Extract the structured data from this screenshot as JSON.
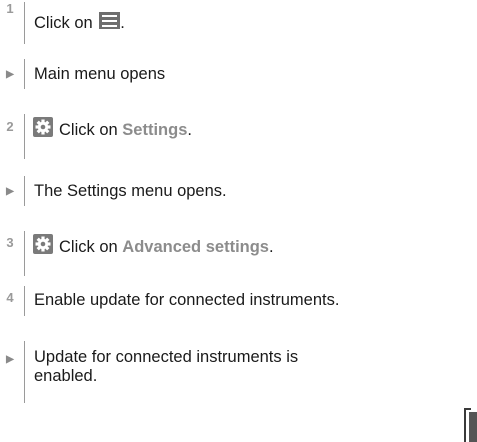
{
  "steps": [
    {
      "marker": "1",
      "text_before": "Click on ",
      "icon": "menu-icon",
      "text_after": "."
    },
    {
      "marker": "▶",
      "text": "Main menu opens"
    },
    {
      "marker": "2",
      "icon": "gear-icon",
      "text_before": "Click on ",
      "bold": "Settings",
      "text_after": "."
    },
    {
      "marker": "▶",
      "text": "The Settings menu opens."
    },
    {
      "marker": "3",
      "icon": "gear-icon",
      "text_before": "Click on ",
      "bold": "Advanced settings",
      "text_after": "."
    },
    {
      "marker": "4",
      "text": "Enable update for connected instruments."
    },
    {
      "marker": "▶",
      "text_line1": "Update for connected instruments is",
      "text_line2": "enabled."
    }
  ]
}
